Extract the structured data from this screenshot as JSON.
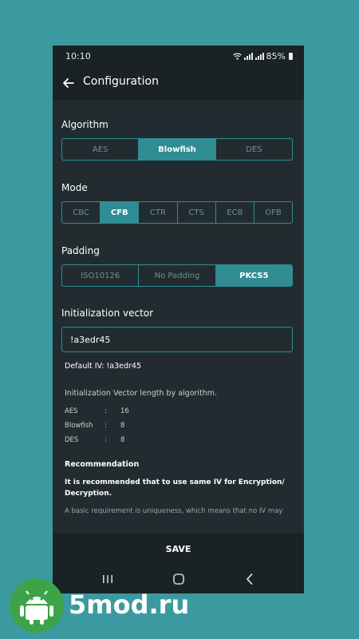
{
  "status_bar": {
    "time": "10:10",
    "battery": "85%"
  },
  "app_bar": {
    "title": "Configuration",
    "back_icon": "arrow-left-icon"
  },
  "algorithm": {
    "label": "Algorithm",
    "options": [
      "AES",
      "Blowfish",
      "DES"
    ],
    "selected": "Blowfish"
  },
  "mode": {
    "label": "Mode",
    "options": [
      "CBC",
      "CFB",
      "CTR",
      "CTS",
      "ECB",
      "OFB"
    ],
    "selected": "CFB"
  },
  "padding": {
    "label": "Padding",
    "options": [
      "ISO10126",
      "No Padding",
      "PKCS5"
    ],
    "selected": "PKCS5"
  },
  "iv": {
    "label": "Initialization vector",
    "value": "!a3edr45",
    "default_text": "Default IV: !a3edr45"
  },
  "iv_lengths": {
    "heading": "Initialization Vector length by algorithm.",
    "rows": [
      {
        "name": "AES",
        "sep": ":",
        "value": "16"
      },
      {
        "name": "Blowfish",
        "sep": ":",
        "value": "8"
      },
      {
        "name": "DES",
        "sep": ":",
        "value": "8"
      }
    ]
  },
  "recommendation": {
    "heading": "Recommendation",
    "line1": "It is recommended that to use same IV for Encryption/",
    "line2": "Decryption.",
    "line3": "A basic requirement is uniqueness, which means that no IV may"
  },
  "save_label": "SAVE",
  "watermark": {
    "text": "5mod.ru",
    "logo_icon": "android-icon"
  },
  "colors": {
    "background": "#3a9aa0",
    "accent": "#2f8d93",
    "surface": "#222c30"
  }
}
